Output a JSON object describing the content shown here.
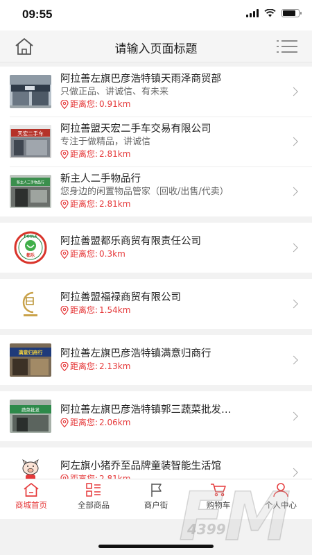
{
  "status": {
    "time": "09:55"
  },
  "header": {
    "title": "请输入页面标题"
  },
  "distance_prefix": "距离您: ",
  "shops": [
    {
      "name": "阿拉善左旗巴彦浩特镇天雨泽商贸部",
      "desc": "只做正品、讲诚信、有未来",
      "distance": "0.91km",
      "thumb": "storefront-photo"
    },
    {
      "name": "阿拉善盟天宏二手车交易有限公司",
      "desc": "专注于做精品，讲诚信",
      "distance": "2.81km",
      "thumb": "storefront-photo"
    },
    {
      "name": "新主人二手物品行",
      "desc": "您身边的闲置物品管家（回收/出售/代卖）",
      "distance": "2.81km",
      "thumb": "storefront-photo"
    },
    {
      "name": "阿拉善盟都乐商贸有限责任公司",
      "desc": "",
      "distance": "0.3km",
      "thumb": "dule-logo"
    },
    {
      "name": "阿拉善盟福禄商贸有限公司",
      "desc": "",
      "distance": "1.54km",
      "thumb": "fulu-logo"
    },
    {
      "name": "阿拉善左旗巴彦浩特镇满意归商行",
      "desc": "",
      "distance": "2.13km",
      "thumb": "storefront-photo"
    },
    {
      "name": "阿拉善左旗巴彦浩特镇郭三蔬菜批发…",
      "desc": "",
      "distance": "2.06km",
      "thumb": "storefront-photo"
    },
    {
      "name": "阿左旗小猪乔至品牌童装智能生活馆",
      "desc": "",
      "distance": "2.81km",
      "thumb": "pig-logo"
    }
  ],
  "thumb_text": {
    "s2": "天宏二手车",
    "s3": "新主人二手物品行",
    "s4_ring": "DOULE",
    "s4_center": "都乐",
    "s6": "满意归商行",
    "s7": "蔬菜批发"
  },
  "tabs": [
    {
      "label": "商城首页",
      "icon": "home-icon",
      "active": true
    },
    {
      "label": "全部商品",
      "icon": "grid-list-icon",
      "active": false
    },
    {
      "label": "商户街",
      "icon": "flag-icon",
      "active": false
    },
    {
      "label": "购物车",
      "icon": "cart-icon",
      "active": false
    },
    {
      "label": "个人中心",
      "icon": "user-icon",
      "active": false
    }
  ],
  "watermark": {
    "text": "FM",
    "sub": "4399"
  },
  "colors": {
    "accent": "#e5393a",
    "background": "#f2f2f2"
  }
}
